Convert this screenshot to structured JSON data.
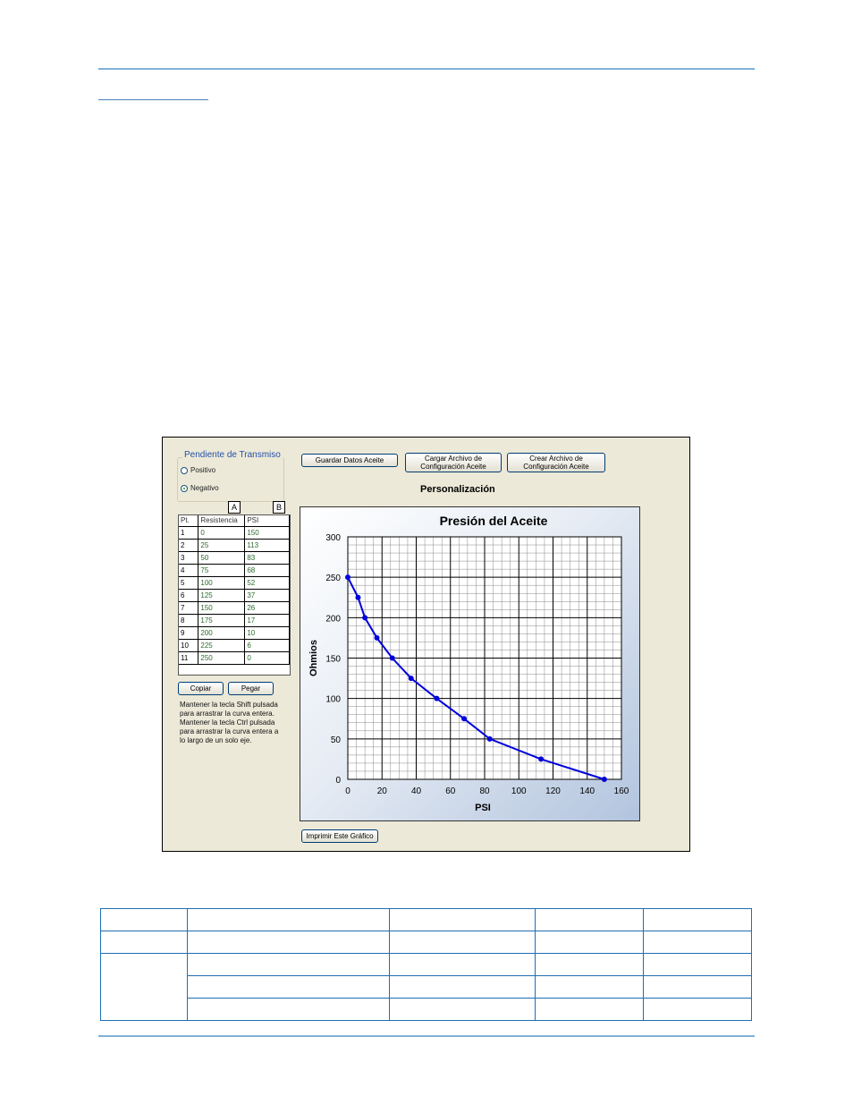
{
  "window": {
    "group_title": "Pendiente de Transmiso",
    "radios": [
      {
        "label": "Positivo",
        "checked": false
      },
      {
        "label": "Negativo",
        "checked": true
      }
    ],
    "column_tags": [
      "A",
      "B"
    ],
    "table": {
      "headers": [
        "Pt.",
        "Resistencia",
        "PSI"
      ],
      "rows": [
        [
          "1",
          "0",
          "150"
        ],
        [
          "2",
          "25",
          "113"
        ],
        [
          "3",
          "50",
          "83"
        ],
        [
          "4",
          "75",
          "68"
        ],
        [
          "5",
          "100",
          "52"
        ],
        [
          "6",
          "125",
          "37"
        ],
        [
          "7",
          "150",
          "26"
        ],
        [
          "8",
          "175",
          "17"
        ],
        [
          "9",
          "200",
          "10"
        ],
        [
          "10",
          "225",
          "6"
        ],
        [
          "11",
          "250",
          "0"
        ]
      ]
    },
    "buttons": {
      "save": "Guardar Datos Aceite",
      "load": "Cargar Archivo de Configuración Aceite",
      "create": "Crear Archivo de Configuración Aceite",
      "copy": "Copiar",
      "paste": "Pegar",
      "print": "Imprimir Este Gráfico"
    },
    "help_text": "Mantener la tecla Shift pulsada para arrastrar la curva entera.  Mantener la tecla Ctrl pulsada para arrastrar la curva entera a lo largo de un solo eje.",
    "chart_caption": "Personalización"
  },
  "chart_data": {
    "type": "line",
    "title": "Presión del Aceite",
    "xlabel": "PSI",
    "ylabel": "Ohmios",
    "xlim": [
      0,
      160
    ],
    "ylim": [
      0,
      300
    ],
    "x_ticks": [
      0,
      20,
      40,
      60,
      80,
      100,
      120,
      140,
      160
    ],
    "y_ticks": [
      0,
      50,
      100,
      150,
      200,
      250,
      300
    ],
    "grid": true,
    "series": [
      {
        "color": "#0000dd",
        "x": [
          150,
          113,
          83,
          68,
          52,
          37,
          26,
          17,
          10,
          6,
          0
        ],
        "y": [
          0,
          25,
          50,
          75,
          100,
          125,
          150,
          175,
          200,
          225,
          250
        ]
      }
    ]
  },
  "doc_table": {
    "rows": 5,
    "cols": 5
  }
}
